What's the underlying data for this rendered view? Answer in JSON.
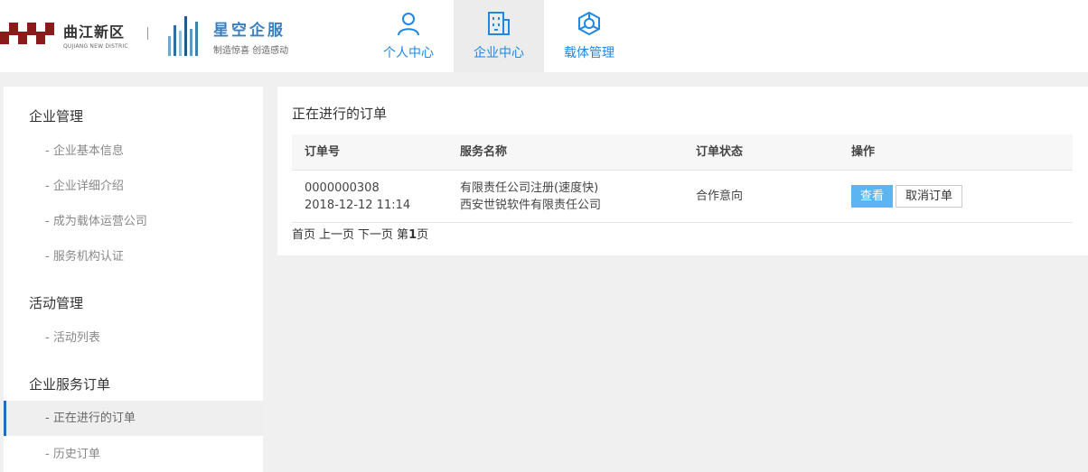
{
  "header": {
    "logo_qujiang": {
      "name": "曲江新区",
      "subtitle": "QUJIANG NEW DISTRIC"
    },
    "logo_xingkong": {
      "name": "星空企服",
      "slogan": "制造惊喜 创造感动"
    },
    "nav": [
      {
        "label": "个人中心",
        "icon": "user-icon"
      },
      {
        "label": "企业中心",
        "icon": "building-icon",
        "active": true
      },
      {
        "label": "载体管理",
        "icon": "hexagon-icon"
      }
    ]
  },
  "sidebar": {
    "groups": [
      {
        "title": "企业管理",
        "items": [
          "- 企业基本信息",
          "- 企业详细介绍",
          "- 成为载体运营公司",
          "- 服务机构认证"
        ]
      },
      {
        "title": "活动管理",
        "items": [
          "- 活动列表"
        ]
      },
      {
        "title": "企业服务订单",
        "items": [
          "- 正在进行的订单",
          "- 历史订单"
        ]
      }
    ],
    "active_item": "- 正在进行的订单"
  },
  "main": {
    "title": "正在进行的订单",
    "columns": [
      "订单号",
      "服务名称",
      "订单状态",
      "操作"
    ],
    "rows": [
      {
        "order_no": "0000000308",
        "date": "2018-12-12 11:14",
        "service": "有限责任公司注册(速度快)",
        "company": "西安世锐软件有限责任公司",
        "status": "合作意向",
        "view_label": "查看",
        "cancel_label": "取消订单"
      }
    ],
    "pager": {
      "first": "首页",
      "prev": "上一页",
      "next": "下一页",
      "page_prefix": "第",
      "page": "1",
      "page_suffix": "页"
    }
  },
  "colors": {
    "accent": "#1e88e5",
    "view_button": "#5bb5f0",
    "brand_red": "#8b1a1a",
    "active_border": "#1e6fc0"
  }
}
